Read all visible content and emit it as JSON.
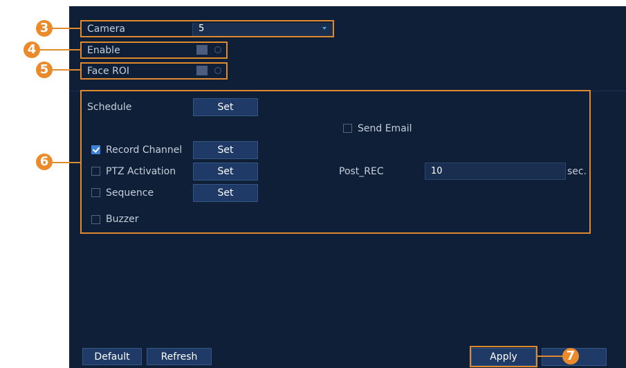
{
  "camera": {
    "label": "Camera",
    "value": "5"
  },
  "enable": {
    "label": "Enable"
  },
  "face_roi": {
    "label": "Face ROI"
  },
  "schedule": {
    "label": "Schedule",
    "button": "Set"
  },
  "send_email": {
    "label": "Send Email",
    "checked": false
  },
  "record_channel": {
    "label": "Record Channel",
    "button": "Set",
    "checked": true
  },
  "ptz_activation": {
    "label": "PTZ Activation",
    "button": "Set",
    "checked": false
  },
  "sequence": {
    "label": "Sequence",
    "button": "Set",
    "checked": false
  },
  "buzzer": {
    "label": "Buzzer",
    "checked": false
  },
  "post_rec": {
    "label": "Post_REC",
    "value": "10",
    "unit": "sec."
  },
  "footer": {
    "default_label": "Default",
    "refresh_label": "Refresh",
    "apply_label": "Apply"
  },
  "callouts": [
    "3",
    "4",
    "5",
    "6",
    "7"
  ],
  "colors": {
    "panel": "#0f1f38",
    "highlight": "#e08a2e",
    "accent": "#3d82d6"
  }
}
